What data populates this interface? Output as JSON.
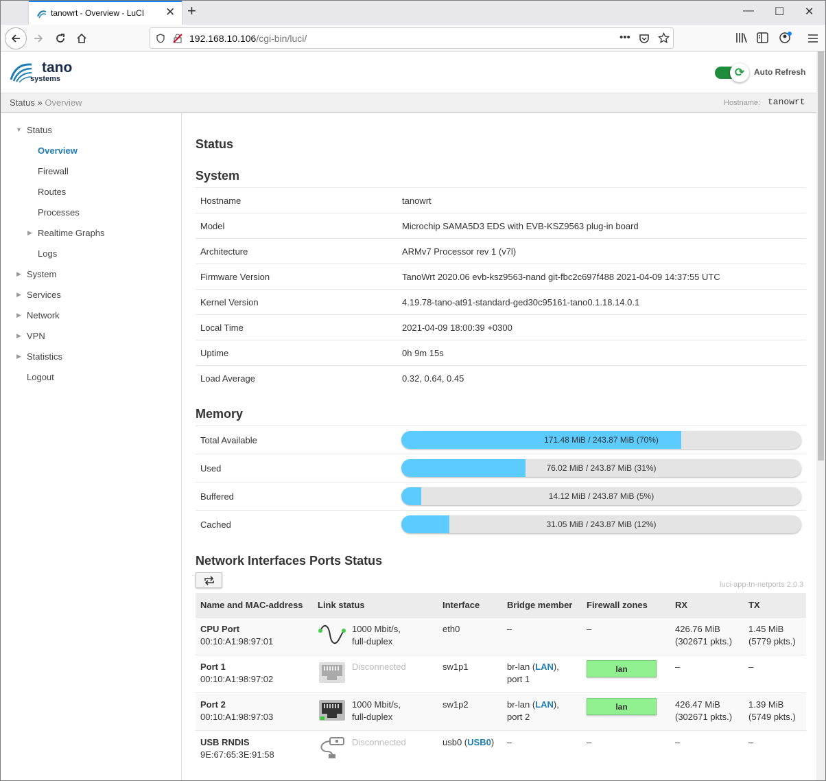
{
  "browser": {
    "tab_title": "tanowrt - Overview - LuCI",
    "url_host": "192.168.10.106",
    "url_path": "/cgi-bin/luci/",
    "url_dots": "•••"
  },
  "header": {
    "brand_top": "tano",
    "brand_bottom": "systems",
    "auto_refresh": "Auto Refresh",
    "auto_refresh_on": true
  },
  "breadcrumb": {
    "first": "Status",
    "sep": " » ",
    "last": "Overview",
    "hostname_label": "Hostname:",
    "hostname": "tanowrt"
  },
  "sidebar": {
    "items": [
      {
        "label": "Status"
      },
      {
        "label": "Overview"
      },
      {
        "label": "Firewall"
      },
      {
        "label": "Routes"
      },
      {
        "label": "Processes"
      },
      {
        "label": "Realtime Graphs"
      },
      {
        "label": "Logs"
      },
      {
        "label": "System"
      },
      {
        "label": "Services"
      },
      {
        "label": "Network"
      },
      {
        "label": "VPN"
      },
      {
        "label": "Statistics"
      },
      {
        "label": "Logout"
      }
    ]
  },
  "page_title": "Status",
  "system": {
    "title": "System",
    "rows": [
      {
        "k": "Hostname",
        "v": "tanowrt"
      },
      {
        "k": "Model",
        "v": "Microchip SAMA5D3 EDS with EVB-KSZ9563 plug-in board"
      },
      {
        "k": "Architecture",
        "v": "ARMv7 Processor rev 1 (v7l)"
      },
      {
        "k": "Firmware Version",
        "v": "TanoWrt 2020.06 evb-ksz9563-nand git-fbc2c697f488 2021-04-09 14:37:55 UTC"
      },
      {
        "k": "Kernel Version",
        "v": "4.19.78-tano-at91-standard-ged30c95161-tano0.1.18.14.0.1"
      },
      {
        "k": "Local Time",
        "v": "2021-04-09 18:00:39 +0300"
      },
      {
        "k": "Uptime",
        "v": "0h 9m 15s"
      },
      {
        "k": "Load Average",
        "v": "0.32, 0.64, 0.45"
      }
    ]
  },
  "memory": {
    "title": "Memory",
    "rows": [
      {
        "k": "Total Available",
        "text": "171.48 MiB / 243.87 MiB (70%)",
        "pct": 70
      },
      {
        "k": "Used",
        "text": "76.02 MiB / 243.87 MiB (31%)",
        "pct": 31
      },
      {
        "k": "Buffered",
        "text": "14.12 MiB / 243.87 MiB (5%)",
        "pct": 5
      },
      {
        "k": "Cached",
        "text": "31.05 MiB / 243.87 MiB (12%)",
        "pct": 12
      }
    ]
  },
  "ports": {
    "title": "Network Interfaces Ports Status",
    "version": "luci-app-tn-netports 2.0.3",
    "headers": [
      "Name and MAC-address",
      "Link status",
      "Interface",
      "Bridge member",
      "Firewall zones",
      "RX",
      "TX"
    ],
    "rows": [
      {
        "name": "CPU Port",
        "mac": "00:10:A1:98:97:01",
        "link1": "1000 Mbit/s,",
        "link2": "full-duplex",
        "iface": "eth0",
        "iface_link": "",
        "bridge": "–",
        "bridge_link": "",
        "bridge_port": "",
        "zone": "",
        "zone_text": "–",
        "rx1": "426.76 MiB",
        "rx2": "(302671 pkts.)",
        "tx1": "1.45 MiB",
        "tx2": "(5779 pkts.)"
      },
      {
        "name": "Port 1",
        "mac": "00:10:A1:98:97:02",
        "link1": "Disconnected",
        "link2": "",
        "iface": "sw1p1",
        "iface_link": "",
        "bridge": "br-lan (",
        "bridge_link": "LAN",
        "bridge_port": "port 1",
        "zone": "lan",
        "zone_text": "",
        "rx1": "–",
        "rx2": "",
        "tx1": "–",
        "tx2": ""
      },
      {
        "name": "Port 2",
        "mac": "00:10:A1:98:97:03",
        "link1": "1000 Mbit/s,",
        "link2": "full-duplex",
        "iface": "sw1p2",
        "iface_link": "",
        "bridge": "br-lan (",
        "bridge_link": "LAN",
        "bridge_port": "port 2",
        "zone": "lan",
        "zone_text": "",
        "rx1": "426.47 MiB",
        "rx2": "(302671 pkts.)",
        "tx1": "1.39 MiB",
        "tx2": "(5749 pkts.)"
      },
      {
        "name": "USB RNDIS",
        "mac": "9E:67:65:3E:91:58",
        "link1": "Disconnected",
        "link2": "",
        "iface": "usb0 (",
        "iface_link": "USB0",
        "bridge": "–",
        "bridge_link": "",
        "bridge_port": "",
        "zone": "",
        "zone_text": "–",
        "rx1": "–",
        "rx2": "",
        "tx1": "–",
        "tx2": ""
      }
    ]
  },
  "colors": {
    "accent": "#1f7cb5",
    "bar_fill": "#5ccbff",
    "zone_lan": "#90f090",
    "toggle": "#1e8c3a"
  }
}
